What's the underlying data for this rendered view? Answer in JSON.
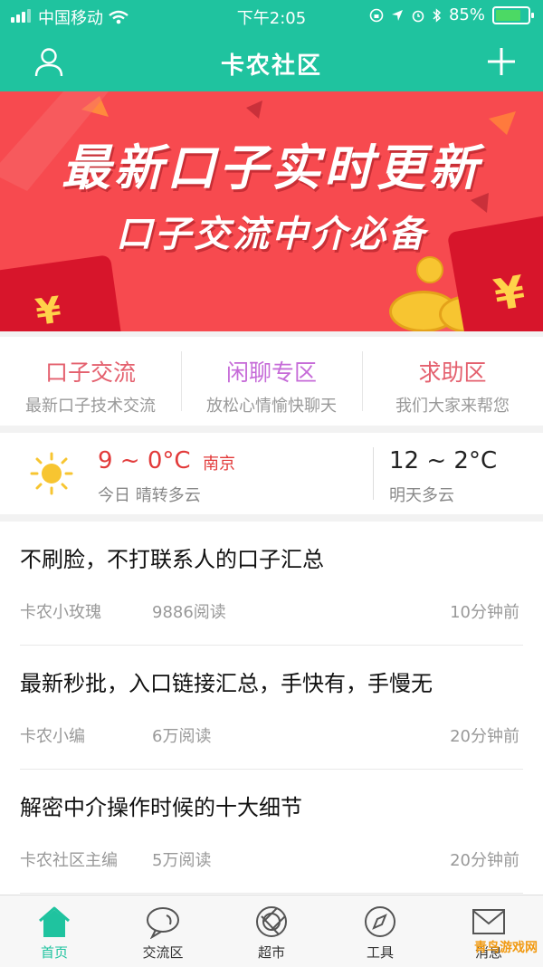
{
  "status_bar": {
    "carrier": "中国移动",
    "time": "下午2:05",
    "battery": "85%"
  },
  "header": {
    "title": "卡农社区"
  },
  "banner": {
    "line1": "最新口子实时更新",
    "line2": "口子交流中介必备"
  },
  "sections": [
    {
      "title": "口子交流",
      "subtitle": "最新口子技术交流",
      "color": "#e4606e"
    },
    {
      "title": "闲聊专区",
      "subtitle": "放松心情愉快聊天",
      "color": "#c66bd8"
    },
    {
      "title": "求助区",
      "subtitle": "我们大家来帮您",
      "color": "#e4606e"
    }
  ],
  "weather": {
    "today_temp": "9 ~ 0°C",
    "city": "南京",
    "today_desc": "今日 晴转多云",
    "tomorrow_temp": "12 ~ 2°C",
    "tomorrow_desc": "明天多云"
  },
  "posts": [
    {
      "title": "不刷脸，不打联系人的口子汇总",
      "author": "卡农小玫瑰",
      "views": "9886阅读",
      "time": "10分钟前"
    },
    {
      "title": "最新秒批，入口链接汇总，手快有，手慢无",
      "author": "卡农小编",
      "views": "6万阅读",
      "time": "20分钟前"
    },
    {
      "title": "解密中介操作时候的十大细节",
      "author": "卡农社区主编",
      "views": "5万阅读",
      "time": "20分钟前"
    }
  ],
  "tabs": [
    {
      "label": "首页",
      "icon": "home-icon"
    },
    {
      "label": "交流区",
      "icon": "chat-icon"
    },
    {
      "label": "超市",
      "icon": "market-icon"
    },
    {
      "label": "工具",
      "icon": "compass-icon"
    },
    {
      "label": "消息",
      "icon": "mail-icon"
    }
  ],
  "watermark": "青鸟游戏网",
  "colors": {
    "brand": "#1fc39f",
    "banner": "#f74a4f",
    "accent_red": "#e23a3a"
  }
}
